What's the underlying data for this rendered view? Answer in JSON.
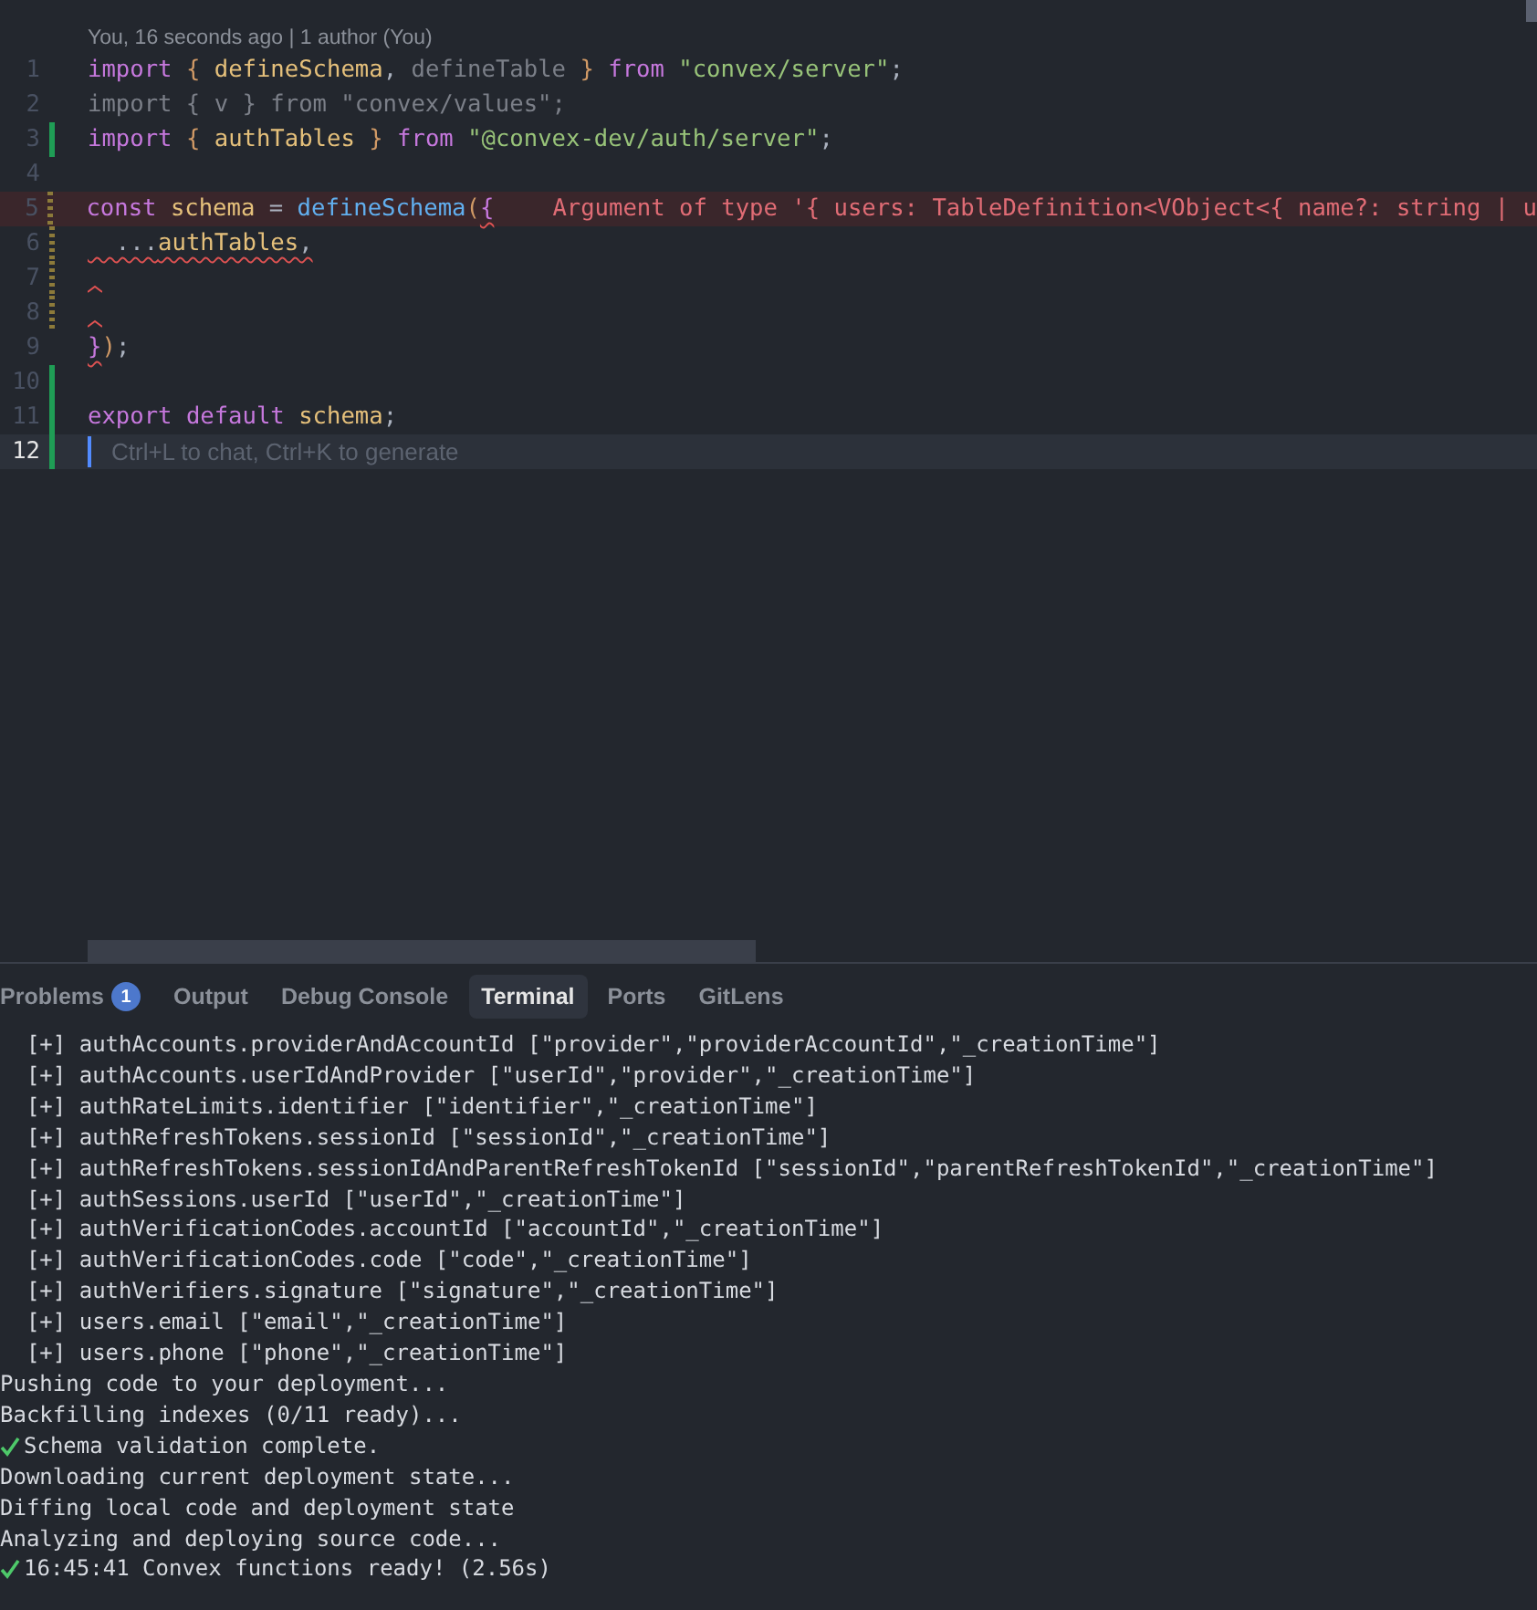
{
  "editor": {
    "blame": "You, 16 seconds ago | 1 author (You)",
    "lines": [
      {
        "number": "1",
        "kind": "unchanged",
        "current": false,
        "error_line": false,
        "squiggle": false,
        "tokens": [
          {
            "t": "import",
            "kind": "keyword",
            "error": false
          },
          {
            "t": " { ",
            "kind": "brace",
            "error": false
          },
          {
            "t": "defineSchema",
            "kind": "variable",
            "error": false
          },
          {
            "t": ", ",
            "kind": "punctuation",
            "error": false
          },
          {
            "t": "defineTable",
            "kind": "unused",
            "error": false
          },
          {
            "t": " } ",
            "kind": "brace",
            "error": false
          },
          {
            "t": "from ",
            "kind": "keyword",
            "error": false
          },
          {
            "t": "\"convex/server\"",
            "kind": "string",
            "error": false
          },
          {
            "t": ";",
            "kind": "punctuation",
            "error": false
          }
        ]
      },
      {
        "number": "2",
        "kind": "unchanged",
        "current": false,
        "error_line": false,
        "squiggle": false,
        "tokens": [
          {
            "t": "import { v } from \"convex/values\";",
            "kind": "unused",
            "error": false
          }
        ]
      },
      {
        "number": "3",
        "kind": "added",
        "current": false,
        "error_line": false,
        "squiggle": false,
        "tokens": [
          {
            "t": "import",
            "kind": "keyword",
            "error": false
          },
          {
            "t": " { ",
            "kind": "brace",
            "error": false
          },
          {
            "t": "authTables",
            "kind": "variable",
            "error": false
          },
          {
            "t": " } ",
            "kind": "brace",
            "error": false
          },
          {
            "t": "from ",
            "kind": "keyword",
            "error": false
          },
          {
            "t": "\"@convex-dev/auth/server\"",
            "kind": "string",
            "error": false
          },
          {
            "t": ";",
            "kind": "punctuation",
            "error": false
          }
        ]
      },
      {
        "number": "4",
        "kind": "unchanged",
        "current": false,
        "error_line": false,
        "squiggle": false
      },
      {
        "number": "5",
        "kind": "modified",
        "current": false,
        "error_line": true,
        "squiggle": false,
        "tokens": [
          {
            "t": "const ",
            "kind": "keyword",
            "error": false
          },
          {
            "t": "schema",
            "kind": "variable",
            "error": false
          },
          {
            "t": " = ",
            "kind": "punctuation",
            "error": false
          },
          {
            "t": "defineSchema",
            "kind": "function",
            "error": false
          },
          {
            "t": "(",
            "kind": "brace",
            "error": false
          },
          {
            "t": "{",
            "kind": "keyword",
            "error": true
          }
        ],
        "message": "Argument of type '{ users: TableDefinition<VObject<{ name?: string | u"
      },
      {
        "number": "6",
        "kind": "modified",
        "current": false,
        "error_line": false,
        "squiggle": false,
        "tokens": [
          {
            "t": "  ...",
            "kind": "punctuation",
            "error": true
          },
          {
            "t": "authTables",
            "kind": "variable",
            "error": true
          },
          {
            "t": ",",
            "kind": "punctuation",
            "error": true
          }
        ]
      },
      {
        "number": "7",
        "kind": "modified",
        "current": false,
        "error_line": false,
        "squiggle": true
      },
      {
        "number": "8",
        "kind": "modified",
        "current": false,
        "error_line": false,
        "squiggle": true
      },
      {
        "number": "9",
        "kind": "unchanged",
        "current": false,
        "error_line": false,
        "squiggle": false,
        "tokens": [
          {
            "t": "}",
            "kind": "keyword",
            "error": true
          },
          {
            "t": ")",
            "kind": "brace",
            "error": false
          },
          {
            "t": ";",
            "kind": "punctuation",
            "error": false
          }
        ]
      },
      {
        "number": "10",
        "kind": "added",
        "current": false,
        "error_line": false,
        "squiggle": false
      },
      {
        "number": "11",
        "kind": "added",
        "current": false,
        "error_line": false,
        "squiggle": false,
        "tokens": [
          {
            "t": "export ",
            "kind": "keyword",
            "error": false
          },
          {
            "t": "default ",
            "kind": "keyword",
            "error": false
          },
          {
            "t": "schema",
            "kind": "variable",
            "error": false
          },
          {
            "t": ";",
            "kind": "punctuation",
            "error": false
          }
        ]
      },
      {
        "number": "12",
        "kind": "added",
        "current": true,
        "error_line": false,
        "squiggle": false,
        "placeholder": "Ctrl+L to chat, Ctrl+K to generate"
      }
    ]
  },
  "panel": {
    "tabs": [
      {
        "label": "Problems",
        "badge": "1",
        "selected": false
      },
      {
        "label": "Output",
        "selected": false
      },
      {
        "label": "Debug Console",
        "selected": false
      },
      {
        "label": "Terminal",
        "selected": true
      },
      {
        "label": "Ports",
        "selected": false
      },
      {
        "label": "GitLens",
        "selected": false
      }
    ],
    "terminal_lines": [
      {
        "text": "  [+] authAccounts.providerAndAccountId [\"provider\",\"providerAccountId\",\"_creationTime\"]",
        "check": false
      },
      {
        "text": "  [+] authAccounts.userIdAndProvider [\"userId\",\"provider\",\"_creationTime\"]",
        "check": false
      },
      {
        "text": "  [+] authRateLimits.identifier [\"identifier\",\"_creationTime\"]",
        "check": false
      },
      {
        "text": "  [+] authRefreshTokens.sessionId [\"sessionId\",\"_creationTime\"]",
        "check": false
      },
      {
        "text": "  [+] authRefreshTokens.sessionIdAndParentRefreshTokenId [\"sessionId\",\"parentRefreshTokenId\",\"_creationTime\"]",
        "check": false
      },
      {
        "text": "  [+] authSessions.userId [\"userId\",\"_creationTime\"]",
        "check": false
      },
      {
        "text": "  [+] authVerificationCodes.accountId [\"accountId\",\"_creationTime\"]",
        "check": false
      },
      {
        "text": "  [+] authVerificationCodes.code [\"code\",\"_creationTime\"]",
        "check": false
      },
      {
        "text": "  [+] authVerifiers.signature [\"signature\",\"_creationTime\"]",
        "check": false
      },
      {
        "text": "  [+] users.email [\"email\",\"_creationTime\"]",
        "check": false
      },
      {
        "text": "  [+] users.phone [\"phone\",\"_creationTime\"]",
        "check": false
      },
      {
        "text": "Pushing code to your deployment...",
        "check": false
      },
      {
        "text": "Backfilling indexes (0/11 ready)...",
        "check": false
      },
      {
        "text": "Schema validation complete.",
        "check": true
      },
      {
        "text": "Downloading current deployment state...",
        "check": false
      },
      {
        "text": "Diffing local code and deployment state",
        "check": false
      },
      {
        "text": "Analyzing and deploying source code...",
        "check": false
      },
      {
        "text": "16:45:41 Convex functions ready! (2.56s)",
        "check": true
      }
    ]
  }
}
